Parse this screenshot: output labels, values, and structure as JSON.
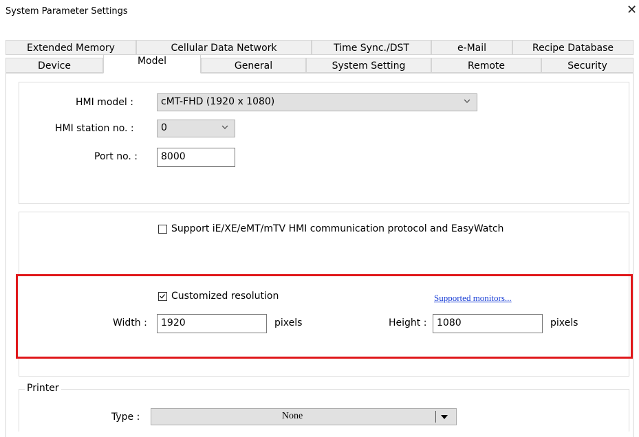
{
  "window": {
    "title": "System Parameter Settings"
  },
  "tabs": {
    "row1": [
      "Extended Memory",
      "Cellular Data Network",
      "Time Sync./DST",
      "e-Mail",
      "Recipe Database"
    ],
    "row2": [
      "Device",
      "Model",
      "General",
      "System Setting",
      "Remote",
      "Security"
    ],
    "active": "Model"
  },
  "model": {
    "hmi_model_label": "HMI model :",
    "hmi_model_value": "cMT-FHD (1920 x 1080)",
    "station_label": "HMI station no. :",
    "station_value": "0",
    "port_label": "Port no. :",
    "port_value": "8000"
  },
  "protocol": {
    "label": "Support iE/XE/eMT/mTV HMI communication protocol and EasyWatch",
    "checked": false
  },
  "resolution": {
    "custom_label": "Customized resolution",
    "checked": true,
    "monitors_link": "Supported monitors...",
    "width_label": "Width :",
    "width_value": "1920",
    "width_unit": "pixels",
    "height_label": "Height :",
    "height_value": "1080",
    "height_unit": "pixels",
    "highlight_color": "#e0171a"
  },
  "printer": {
    "group_label": "Printer",
    "type_label": "Type :",
    "type_value": "None"
  }
}
